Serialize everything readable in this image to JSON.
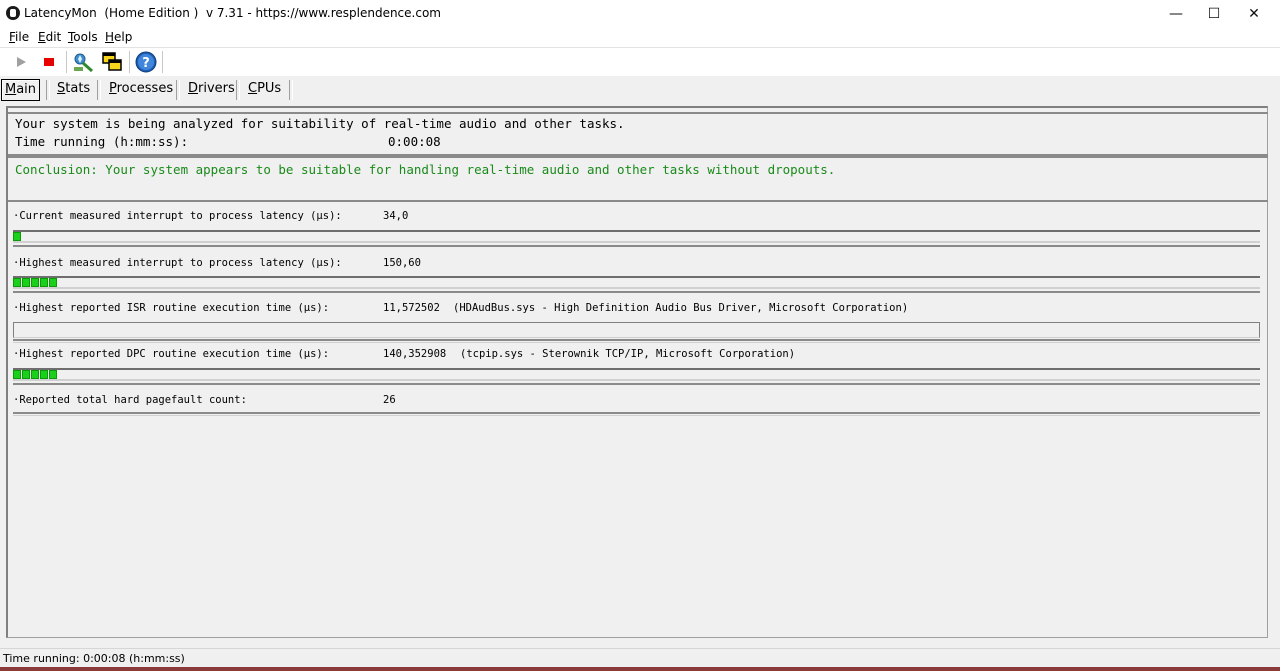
{
  "window": {
    "title": "LatencyMon  (Home Edition )  v 7.31 - https://www.resplendence.com",
    "minimize_glyph": "—",
    "maximize_glyph": "☐",
    "close_glyph": "✕"
  },
  "menu": {
    "file": {
      "u": "F",
      "rest": "ile"
    },
    "edit": {
      "u": "E",
      "rest": "dit"
    },
    "tools": {
      "u": "T",
      "rest": "ools"
    },
    "help": {
      "u": "H",
      "rest": "elp"
    }
  },
  "toolbar": {
    "icons": [
      "play-icon",
      "stop-icon",
      "wizard-icon",
      "windows-icon",
      "help-icon"
    ],
    "colors": {
      "stop": "#e60000",
      "play": "#a0a0a0",
      "help": "#1e5fb4"
    }
  },
  "tabs": [
    {
      "u": "M",
      "rest": "ain",
      "active": true
    },
    {
      "u": "S",
      "rest": "tats",
      "active": false
    },
    {
      "u": "P",
      "rest": "rocesses",
      "active": false
    },
    {
      "u": "D",
      "rest": "rivers",
      "active": false
    },
    {
      "u": "C",
      "rest": "PUs",
      "active": false
    }
  ],
  "main": {
    "analysis_line": "Your system is being analyzed for suitability of real-time audio and other tasks.",
    "time_label": "Time running (h:mm:ss):",
    "time_value": "0:00:08",
    "conclusion": "Conclusion: Your system appears to be suitable for handling real-time audio and other tasks without dropouts.",
    "conclusion_color": "#1a8a1a",
    "metrics": [
      {
        "label": "·Current measured interrupt to process latency (µs):",
        "value": "34,0",
        "extra": "",
        "bar_blocks": 1
      },
      {
        "label": "·Highest measured interrupt to process latency (µs):",
        "value": "150,60",
        "extra": "",
        "bar_blocks": 5
      },
      {
        "label": "·Highest reported ISR routine execution time (µs):",
        "value": "11,572502",
        "extra": "(HDAudBus.sys - High Definition Audio Bus Driver, Microsoft Corporation)",
        "bar_blocks": 0
      },
      {
        "label": "·Highest reported DPC routine execution time (µs):",
        "value": "140,352908",
        "extra": "(tcpip.sys - Sterownik TCP/IP, Microsoft Corporation)",
        "bar_blocks": 5
      },
      {
        "label": "·Reported total hard pagefault count:",
        "value": "26",
        "extra": "",
        "bar_blocks": null
      }
    ],
    "bar_color": "#1bd01b"
  },
  "status": {
    "text": "Time running: 0:00:08  (h:mm:ss)"
  }
}
